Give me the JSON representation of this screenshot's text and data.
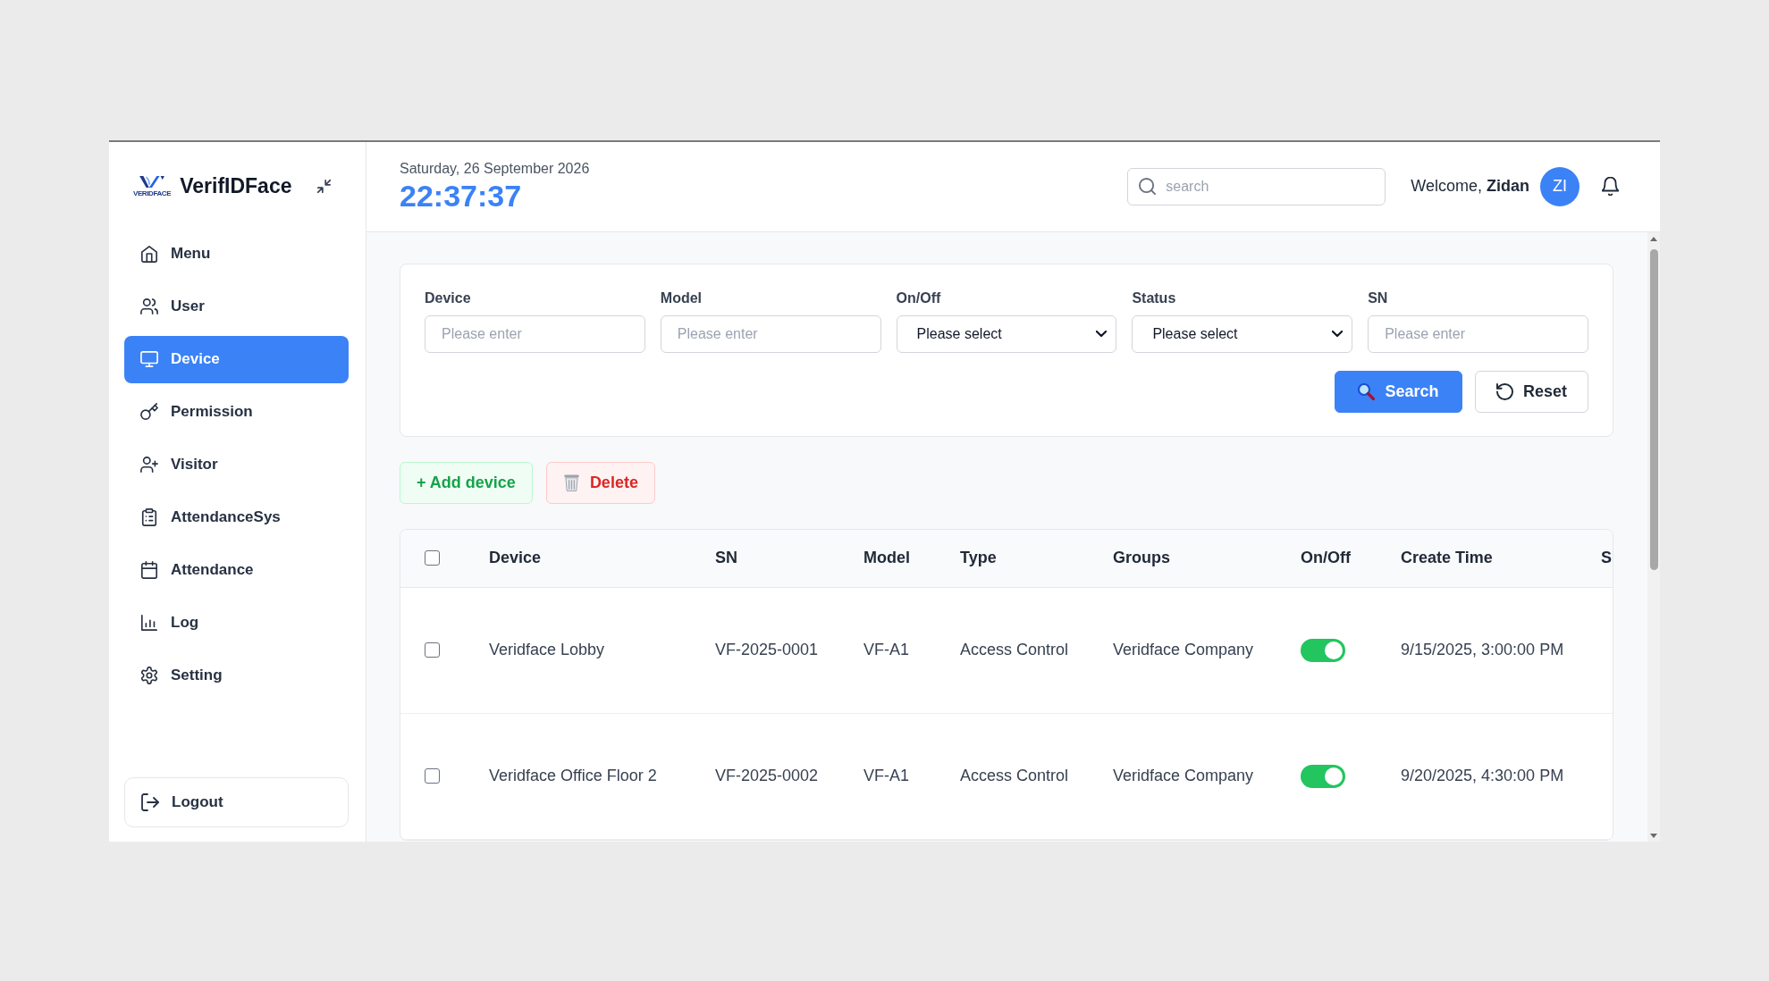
{
  "sidebar": {
    "logo_caption": "VERIDFACE",
    "app_name": "VerifIDFace",
    "items": [
      {
        "label": "Menu",
        "selected": false
      },
      {
        "label": "User",
        "selected": false
      },
      {
        "label": "Device",
        "selected": true
      },
      {
        "label": "Permission",
        "selected": false
      },
      {
        "label": "Visitor",
        "selected": false
      },
      {
        "label": "AttendanceSys",
        "selected": false
      },
      {
        "label": "Attendance",
        "selected": false
      },
      {
        "label": "Log",
        "selected": false
      },
      {
        "label": "Setting",
        "selected": false
      }
    ],
    "logout": "Logout"
  },
  "header": {
    "date": "Saturday, 26 September 2026",
    "time": "22:37:37",
    "search": {
      "placeholder": "search"
    },
    "welcome": "Welcome, **Zidan**",
    "avatar": "ZI"
  },
  "filters": {
    "fields": [
      {
        "label": "Device",
        "kind": "input",
        "placeholder": "Please enter"
      },
      {
        "label": "Model",
        "kind": "input",
        "placeholder": "Please enter"
      },
      {
        "label": "On/Off",
        "kind": "select",
        "value": "Please select"
      },
      {
        "label": "Status",
        "kind": "select",
        "value": "Please select"
      },
      {
        "label": "SN",
        "kind": "input",
        "placeholder": "Please enter"
      }
    ],
    "buttons": [
      {
        "label": "Search",
        "kind": "primary"
      },
      {
        "label": "Reset",
        "kind": "reset"
      }
    ]
  },
  "toolbar": {
    "buttons": [
      {
        "label": "+ Add device",
        "kind": "add"
      },
      {
        "label": "Delete",
        "kind": "delete"
      }
    ]
  },
  "table": {
    "select_all": {
      "checked": false
    },
    "columns": [
      "Device",
      "SN",
      "Model",
      "Type",
      "Groups",
      "On/Off",
      "Create Time",
      "S"
    ],
    "rows": [
      {
        "checked": false,
        "device": "Veridface Lobby",
        "sn": "VF-2025-0001",
        "model": "VF-A1",
        "type": "Access Control",
        "groups": "Veridface Company",
        "on": true,
        "create_time": "9/15/2025, 3:00:00 PM"
      },
      {
        "checked": false,
        "device": "Veridface Office Floor 2",
        "sn": "VF-2025-0002",
        "model": "VF-A1",
        "type": "Access Control",
        "groups": "Veridface Company",
        "on": true,
        "create_time": "9/20/2025, 4:30:00 PM"
      }
    ]
  }
}
